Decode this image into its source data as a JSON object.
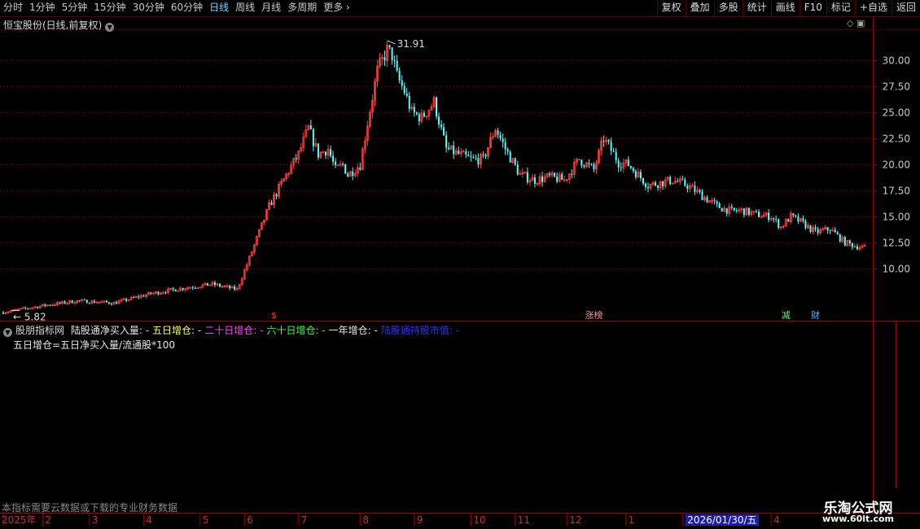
{
  "toolbar": {
    "periods": [
      "分时",
      "1分钟",
      "5分钟",
      "15分钟",
      "30分钟",
      "60分钟",
      "日线",
      "周线",
      "月线",
      "多周期",
      "更多 ›"
    ],
    "active_period": "日线",
    "right_buttons": [
      "复权",
      "叠加",
      "多股",
      "统计",
      "画线",
      "F10",
      "标记",
      "+自选",
      "返回"
    ]
  },
  "chart_title": "恒宝股份(日线,前复权)",
  "price_axis": {
    "ticks": [
      10.0,
      12.5,
      15.0,
      17.5,
      20.0,
      22.5,
      25.0,
      27.5,
      30.0
    ],
    "ylim": [
      5.0,
      33.0
    ]
  },
  "annotations": {
    "high_label": "31.91",
    "low_label": "5.82"
  },
  "event_markers": [
    {
      "text": "$",
      "x_day": 110,
      "color": "#ff3030"
    },
    {
      "text": "涨榜",
      "x_day": 240,
      "color": "#ff9090"
    },
    {
      "text": "减",
      "x_day": 318,
      "color": "#60ff60"
    },
    {
      "text": "财",
      "x_day": 330,
      "color": "#60b0ff"
    }
  ],
  "indicator": {
    "name": "股朋指标网",
    "series": [
      {
        "label": "陆股通净买入量:",
        "value": "-",
        "color": "#e8e8e8"
      },
      {
        "label": "五日增仓:",
        "value": "-",
        "color": "#ffff40"
      },
      {
        "label": "二十日增仓:",
        "value": "-",
        "color": "#ff40ff"
      },
      {
        "label": "六十日增仓:",
        "value": "-",
        "color": "#40ff40"
      },
      {
        "label": "一年增仓:",
        "value": "-",
        "color": "#e8e8e8"
      },
      {
        "label": "陆股通持股市值:",
        "value": "-",
        "color": "#3030ff"
      }
    ],
    "formula": "五日增仓=五日净买入量/流通股*100"
  },
  "footer_note": "本指标需要云数据或下载的专业财务数据",
  "time_axis": {
    "labels": [
      "2025年",
      "2",
      "3",
      "4",
      "5",
      "6",
      "7",
      "8",
      "9",
      "10",
      "11",
      "12",
      "1",
      "2026/01/30/五",
      "4"
    ],
    "label_days": [
      0,
      16,
      35,
      57,
      80,
      98,
      120,
      145,
      167,
      190,
      208,
      229,
      253,
      276,
      312
    ]
  },
  "watermark": {
    "text": "乐淘公式网",
    "url": "www.60lt.com"
  },
  "colors": {
    "up": "#ff3c3c",
    "down": "#54ffff",
    "grid": "#6e0000",
    "frame": "#a00000"
  },
  "chart_data": {
    "type": "candlestick",
    "title": "恒宝股份(日线,前复权)",
    "anchors_day": [
      0,
      15,
      30,
      45,
      60,
      75,
      85,
      95,
      100,
      108,
      115,
      120,
      124,
      128,
      132,
      135,
      138,
      140,
      145,
      148,
      152,
      156,
      158,
      160,
      163,
      166,
      170,
      175,
      180,
      185,
      190,
      195,
      200,
      204,
      210,
      216,
      222,
      228,
      234,
      240,
      244,
      248,
      250,
      254,
      258,
      262,
      268,
      272,
      278,
      284,
      290,
      296,
      300,
      306,
      312,
      316,
      320,
      324,
      330,
      336,
      342,
      346,
      350
    ],
    "anchors_close": [
      5.8,
      6.4,
      6.9,
      6.7,
      7.6,
      8.2,
      8.5,
      8.0,
      11.0,
      16.0,
      19.0,
      21.0,
      23.5,
      21.0,
      21.5,
      19.5,
      20.0,
      19.0,
      20.0,
      24.0,
      29.0,
      31.0,
      30.5,
      28.5,
      27.0,
      25.0,
      24.5,
      26.0,
      21.5,
      21.0,
      20.5,
      20.5,
      23.5,
      21.5,
      19.0,
      18.5,
      18.8,
      18.5,
      20.5,
      19.5,
      22.5,
      21.0,
      20.2,
      20.0,
      19.0,
      18.0,
      18.3,
      18.5,
      18.0,
      17.0,
      16.0,
      15.5,
      15.6,
      15.2,
      15.0,
      14.0,
      15.0,
      14.5,
      13.5,
      13.8,
      12.5,
      12.2,
      12.0
    ]
  }
}
